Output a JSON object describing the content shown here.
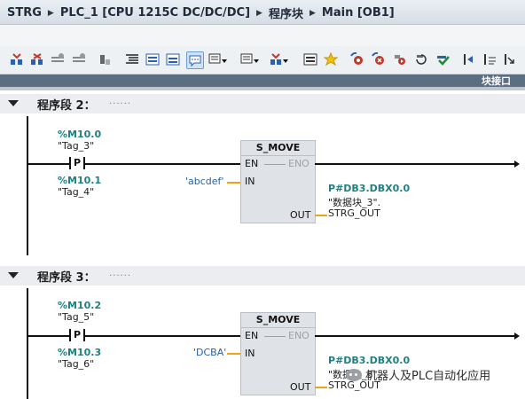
{
  "breadcrumb": {
    "items": [
      "STRG",
      "PLC_1 [CPU 1215C DC/DC/DC]",
      "程序块",
      "Main [OB1]"
    ]
  },
  "toolbar": {
    "icons": [
      "network-insert-icon",
      "network-delete-icon",
      "network-insert-below-icon",
      "network-insert-above-icon",
      "reset-icon",
      "open-all-networks-icon",
      "close-all-networks-icon",
      "show-favorites-icon",
      "comment-toggle-icon",
      "move-down-icon",
      "move-up-icon",
      "go-to-icon",
      "show-list-icon",
      "favorite-icon",
      "monitor-icon",
      "monitor-off-icon",
      "force-icon",
      "modify-icon",
      "breakpoint-icon",
      "step-icon",
      "filter-icon",
      "step-in-icon"
    ]
  },
  "interface_bar": {
    "label": "块接口"
  },
  "networks": [
    {
      "title": "程序段 2：",
      "dots": "......",
      "contact_top": {
        "address": "%M10.0",
        "tag": "\"Tag_3\""
      },
      "contact_label": "P",
      "contact_bottom": {
        "address": "%M10.1",
        "tag": "\"Tag_4\""
      },
      "block": {
        "name": "S_MOVE",
        "en": "EN",
        "eno": "ENO",
        "in": "IN",
        "out": "OUT",
        "in_value": "'abcdef'",
        "out_address": "P#DB3.DBX0.0",
        "out_tag_line1": "\"数据块_3\".",
        "out_tag_line2": "STRG_OUT"
      }
    },
    {
      "title": "程序段 3：",
      "dots": "......",
      "contact_top": {
        "address": "%M10.2",
        "tag": "\"Tag_5\""
      },
      "contact_label": "P",
      "contact_bottom": {
        "address": "%M10.3",
        "tag": "\"Tag_6\""
      },
      "block": {
        "name": "S_MOVE",
        "en": "EN",
        "eno": "ENO",
        "in": "IN",
        "out": "OUT",
        "in_value": "'DCBA'",
        "out_address": "P#DB3.DBX0.0",
        "out_tag_line1": "\"数据块_3\".",
        "out_tag_line2": "STRG_OUT"
      }
    }
  ],
  "watermark": {
    "text": "机器人及PLC自动化应用"
  },
  "colors": {
    "address": "#1f7f83",
    "constant": "#2860a8",
    "wire_orange": "#f0a21a",
    "box_fill": "#dfe3e7",
    "interface_bar": "#5c6f80"
  }
}
